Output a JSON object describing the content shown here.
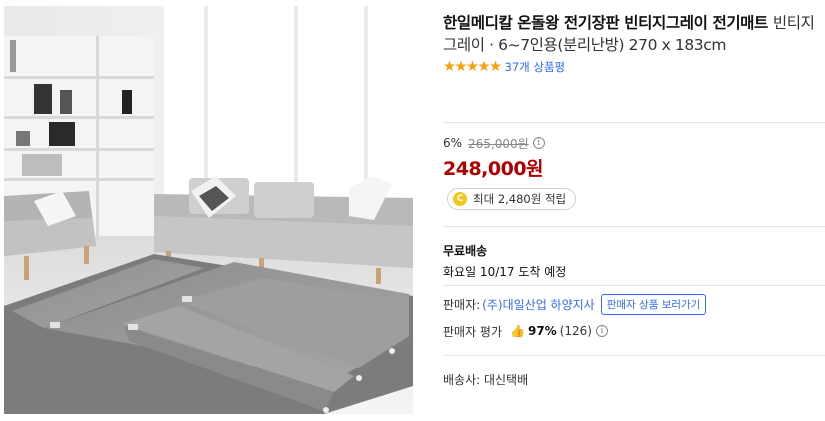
{
  "product": {
    "name": "한일메디칼 온돌왕 전기장판 빈티지그레이 전기매트",
    "option": "빈티지그레이 · 6~7인용(분리난방) 270 x 183cm",
    "rating_stars": 5,
    "review_count": "37개 상품평"
  },
  "price": {
    "discount_rate": "6%",
    "original": "265,000원",
    "sale": "248,000원"
  },
  "reward": {
    "coin_symbol": "C",
    "text": "최대 2,480원 적립"
  },
  "shipping": {
    "title": "무료배송",
    "arrival": "화요일 10/17 도착 예정"
  },
  "seller": {
    "label": "판매자:",
    "name": "(주)대일산업 하양지사",
    "button": "판매자 상품 보러가기"
  },
  "seller_rating": {
    "label": "판매자 평가",
    "percent": "97%",
    "count": "(126)"
  },
  "courier": {
    "text": "배송사: 대신택배"
  },
  "colors": {
    "sale_price": "#ae0000",
    "link": "#346aff",
    "star": "#f8a10d"
  }
}
